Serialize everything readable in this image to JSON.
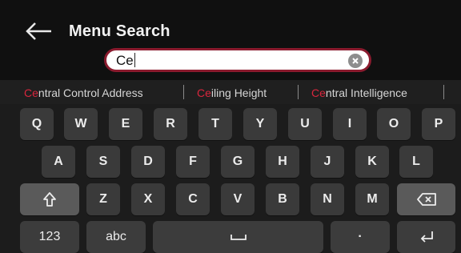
{
  "header": {
    "title": "Menu Search",
    "back_icon": "back-arrow-icon"
  },
  "search": {
    "value": "Ce",
    "clear_icon": "clear-circle-icon"
  },
  "suggestions": [
    {
      "prefix": "Ce",
      "rest": "ntral Control Address"
    },
    {
      "prefix": "Ce",
      "rest": "iling Height"
    },
    {
      "prefix": "Ce",
      "rest": "ntral Intelligence"
    }
  ],
  "keyboard": {
    "row1": [
      "Q",
      "W",
      "E",
      "R",
      "T",
      "Y",
      "U",
      "I",
      "O",
      "P"
    ],
    "row2": [
      "A",
      "S",
      "D",
      "F",
      "G",
      "H",
      "J",
      "K",
      "L"
    ],
    "row3": [
      "Z",
      "X",
      "C",
      "V",
      "B",
      "N",
      "M"
    ],
    "shift_icon": "shift-icon",
    "backspace_icon": "backspace-icon",
    "numbers_label": "123",
    "abc_label": "abc",
    "space_icon": "space-icon",
    "period_label": "·",
    "enter_icon": "enter-icon"
  },
  "colors": {
    "highlight": "#d8263d",
    "search_border": "#8a1b2e"
  }
}
